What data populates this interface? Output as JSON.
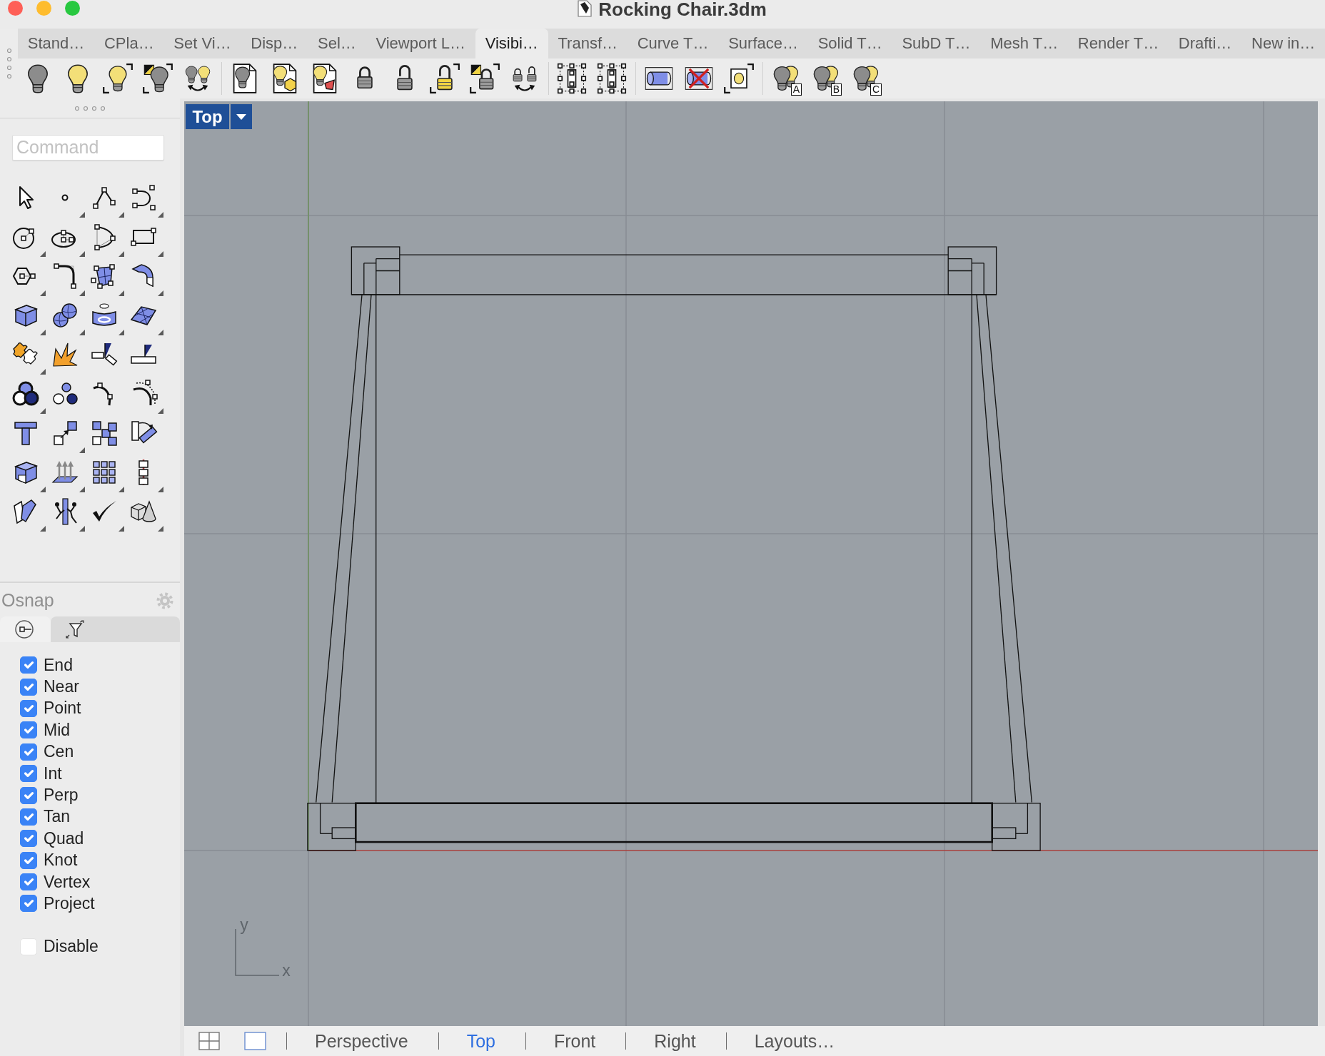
{
  "window": {
    "title": "Rocking Chair.3dm"
  },
  "toolbar_tabs": [
    {
      "label": "Stand…",
      "selected": false
    },
    {
      "label": "CPla…",
      "selected": false
    },
    {
      "label": "Set Vi…",
      "selected": false
    },
    {
      "label": "Disp…",
      "selected": false
    },
    {
      "label": "Sel…",
      "selected": false
    },
    {
      "label": "Viewport L…",
      "selected": false
    },
    {
      "label": "Visibi…",
      "selected": true
    },
    {
      "label": "Transf…",
      "selected": false
    },
    {
      "label": "Curve T…",
      "selected": false
    },
    {
      "label": "Surface…",
      "selected": false
    },
    {
      "label": "Solid T…",
      "selected": false
    },
    {
      "label": "SubD T…",
      "selected": false
    },
    {
      "label": "Mesh T…",
      "selected": false
    },
    {
      "label": "Render T…",
      "selected": false
    },
    {
      "label": "Drafti…",
      "selected": false
    },
    {
      "label": "New in…",
      "selected": false
    }
  ],
  "toolbar": {
    "icon_letters": [
      "A",
      "B",
      "C"
    ]
  },
  "command": {
    "placeholder": "Command"
  },
  "osnap": {
    "title": "Osnap",
    "tabs": [
      {
        "selected": true
      },
      {
        "selected": false
      }
    ],
    "items": [
      {
        "label": "End",
        "checked": true
      },
      {
        "label": "Near",
        "checked": true
      },
      {
        "label": "Point",
        "checked": true
      },
      {
        "label": "Mid",
        "checked": true
      },
      {
        "label": "Cen",
        "checked": true
      },
      {
        "label": "Int",
        "checked": true
      },
      {
        "label": "Perp",
        "checked": true
      },
      {
        "label": "Tan",
        "checked": true
      },
      {
        "label": "Quad",
        "checked": true
      },
      {
        "label": "Knot",
        "checked": true
      },
      {
        "label": "Vertex",
        "checked": true
      },
      {
        "label": "Project",
        "checked": true
      }
    ],
    "disable": {
      "label": "Disable",
      "checked": false
    }
  },
  "viewport": {
    "name": "Top",
    "axis_labels": [
      "y",
      "x"
    ]
  },
  "view_tabs": [
    {
      "label": "Perspective",
      "selected": false
    },
    {
      "label": "Top",
      "selected": true
    },
    {
      "label": "Front",
      "selected": false
    },
    {
      "label": "Right",
      "selected": false
    },
    {
      "label": "Layouts…",
      "selected": false
    }
  ]
}
